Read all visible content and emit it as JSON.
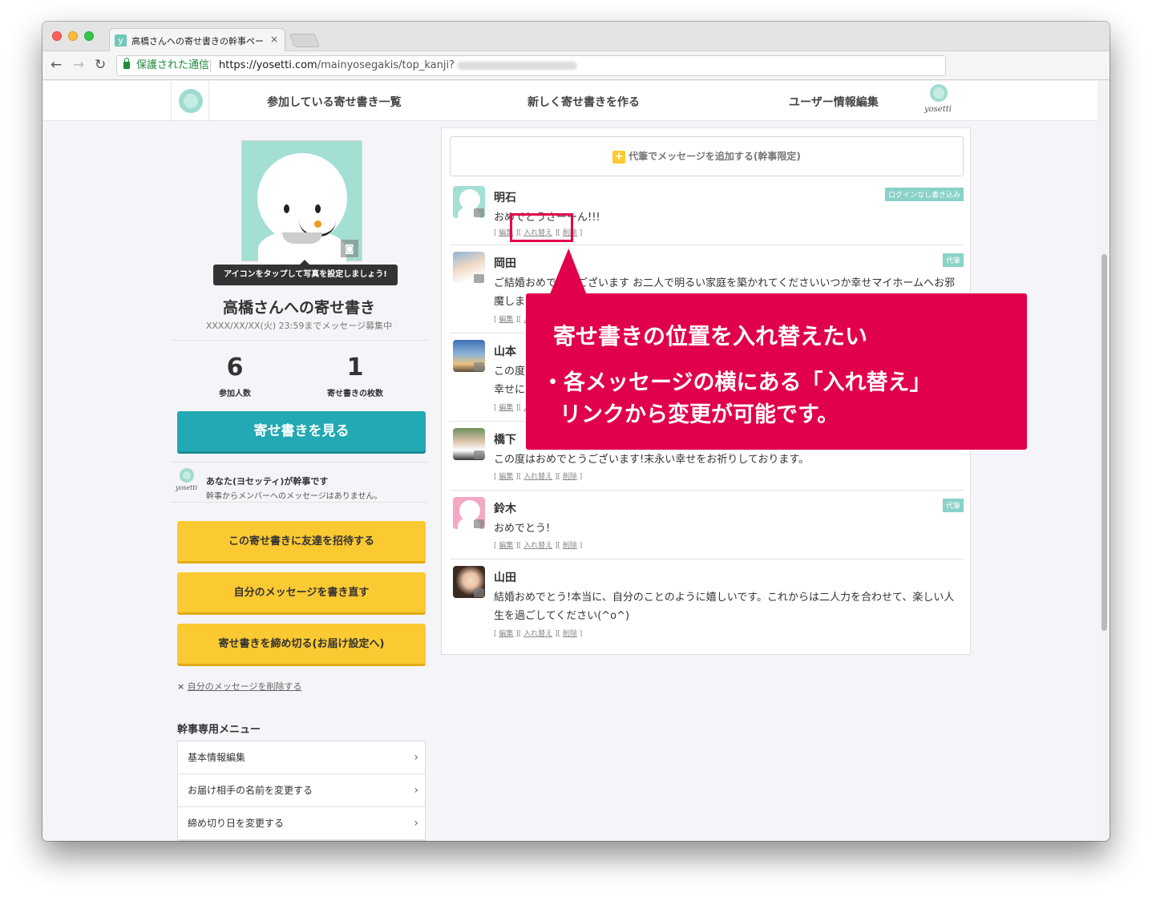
{
  "browser": {
    "tab_title": "高橋さんへの寄せ書きの幹事ペー",
    "tab_close": "×",
    "tab_favicon": "y",
    "secure_label": "保護された通信",
    "url_host": "https://yosetti.com",
    "url_path": "/mainyosegakis/top_kanji?",
    "back": "←",
    "forward": "→",
    "reload": "↻"
  },
  "nav": {
    "participating": "参加している寄せ書き一覧",
    "create_new": "新しく寄せ書きを作る",
    "user_edit": "ユーザー情報編集",
    "brand": "yosetti"
  },
  "left": {
    "camera_icon": "◙",
    "tooltip": "アイコンをタップして写真を設定しましょう!",
    "title": "高橋さんへの寄せ書き",
    "deadline": "XXXX/XX/XX(火) 23:59までメッセージ募集中",
    "stats": [
      {
        "num": "6",
        "label": "参加人数"
      },
      {
        "num": "1",
        "label": "寄せ書きの枚数"
      }
    ],
    "view_button": "寄せ書きを見る",
    "kanji_line1": "あなた(ヨセッティ)が幹事です",
    "kanji_line2": "幹事からメンバーへのメッセージはありません。",
    "kanji_brand": "yosetti",
    "invite_button": "この寄せ書きに友達を招待する",
    "rewrite_button": "自分のメッセージを書き直す",
    "close_button": "寄せ書きを締め切る(お届け設定へ)",
    "delete_x": "×",
    "delete_link": "自分のメッセージを削除する",
    "menu_title": "幹事専用メニュー",
    "menu_items": [
      "基本情報編集",
      "お届け相手の名前を変更する",
      "締め切り日を変更する"
    ],
    "chevron": "›"
  },
  "right": {
    "add_plus": "+",
    "add_message": "代筆でメッセージを追加する(幹事限定)",
    "link_edit": "編集",
    "link_swap": "入れ替え",
    "link_delete": "削除",
    "messages": [
      {
        "name": "明石",
        "text": "おめでとうさーーん!!!",
        "badge": "ログインなし書き込み"
      },
      {
        "name": "岡田",
        "text": "ご結婚おめでとうございます お二人で明るい家庭を築かれてくださいいつか幸せマイホームへお邪魔します!",
        "badge": "代筆"
      },
      {
        "name": "山本",
        "text": "この度はご結婚おめでとうございます!お二人の末永い幸せを心からお祈りしております。どうかお幸せに",
        "badge": ""
      },
      {
        "name": "橋下",
        "text": "この度はおめでとうございます!末永い幸せをお祈りしております。",
        "badge": ""
      },
      {
        "name": "鈴木",
        "text": "おめでとう!",
        "badge": "代筆"
      },
      {
        "name": "山田",
        "text": "結婚おめでとう!本当に、自分のことのように嬉しいです。これからは二人力を合わせて、楽しい人生を過ごしてください(^o^)",
        "badge": ""
      }
    ]
  },
  "callout": {
    "title": "寄せ書きの位置を入れ替えたい",
    "body_line1": "・各メッセージの横にある「入れ替え」",
    "body_line2": "リンクから変更が可能です。"
  },
  "colors": {
    "teal": "#22a9b3",
    "yellow": "#fbc931",
    "callout": "#e1004b",
    "badge": "#89d2c8"
  }
}
